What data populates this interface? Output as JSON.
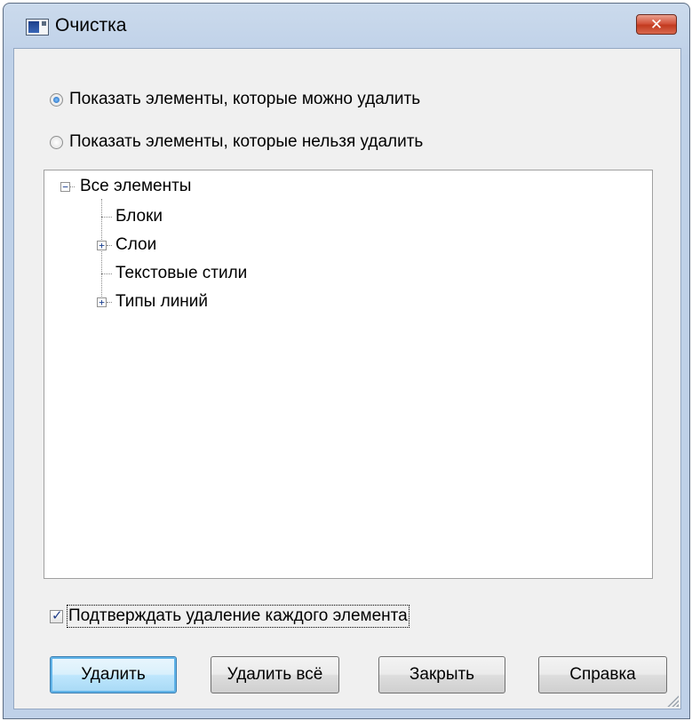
{
  "window": {
    "title": "Очистка",
    "close_glyph": "✕"
  },
  "radios": [
    {
      "label": "Показать элементы, которые можно удалить",
      "checked": true
    },
    {
      "label": "Показать элементы, которые нельзя удалить",
      "checked": false
    }
  ],
  "tree": {
    "root": {
      "label": "Все элементы",
      "expander": "−"
    },
    "children": [
      {
        "label": "Блоки",
        "expander": ""
      },
      {
        "label": "Слои",
        "expander": "+"
      },
      {
        "label": "Текстовые стили",
        "expander": ""
      },
      {
        "label": "Типы линий",
        "expander": "+"
      }
    ]
  },
  "confirm": {
    "label": "Подтверждать удаление каждого элемента",
    "checked": true
  },
  "buttons": {
    "delete": "Удалить",
    "delete_all": "Удалить всё",
    "close": "Закрыть",
    "help": "Справка"
  },
  "colors": {
    "frame": "#bfd1e8",
    "client": "#f0f0f0",
    "close_button": "#c23a1f",
    "default_button": "#bee6fd"
  },
  "icons": [
    "app-icon",
    "close-icon",
    "expand-icon",
    "collapse-icon",
    "resize-grip-icon"
  ]
}
